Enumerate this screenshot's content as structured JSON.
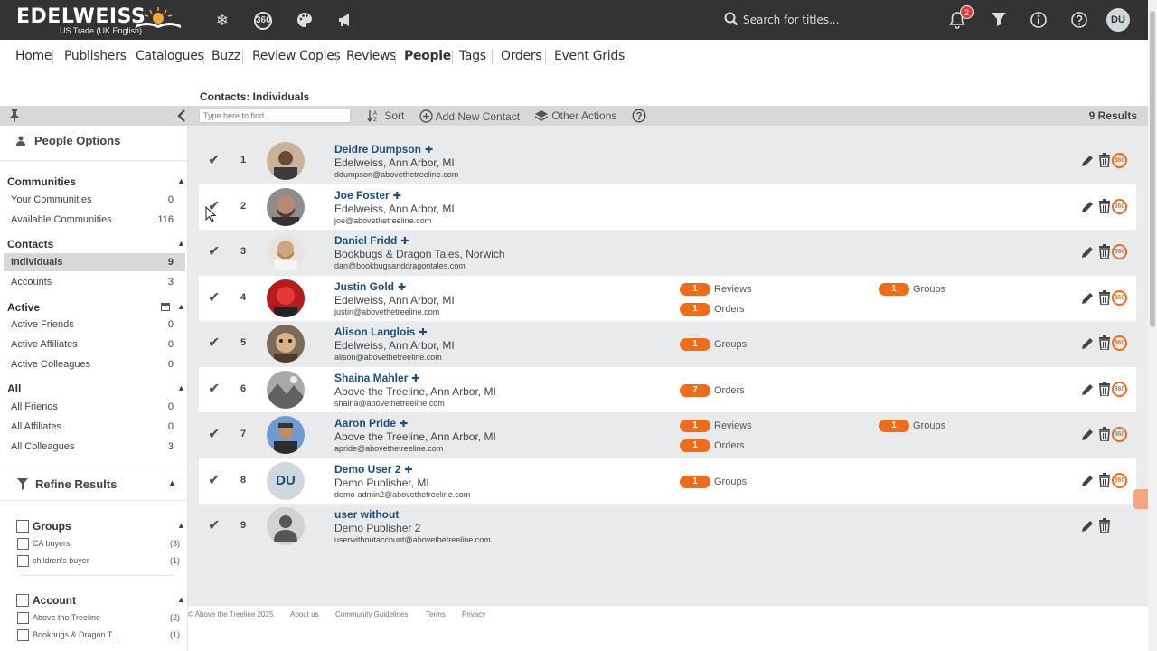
{
  "brand": {
    "name": "EDELWEISS",
    "subtitle": "US Trade (UK English)"
  },
  "header": {
    "search_placeholder": "Search for titles...",
    "notification_count": "2",
    "user_initials": "DU",
    "icon_360": "360"
  },
  "nav": [
    "Home",
    "Publishers",
    "Catalogues",
    "Buzz",
    "Review Copies",
    "Reviews",
    "People",
    "Tags",
    "Orders",
    "Event Grids"
  ],
  "breadcrumb": "Contacts: Individuals",
  "toolbar": {
    "find_placeholder": "Type here to find...",
    "sort": "Sort",
    "add_contact": "Add New Contact",
    "other_actions": "Other Actions",
    "results": "9 Results"
  },
  "sidebar": {
    "title": "People Options",
    "communities_head": "Communities",
    "communities": [
      {
        "label": "Your Communities",
        "count": "0"
      },
      {
        "label": "Available Communities",
        "count": "116"
      }
    ],
    "contacts_head": "Contacts",
    "contacts": [
      {
        "label": "Individuals",
        "count": "9"
      },
      {
        "label": "Accounts",
        "count": "3"
      }
    ],
    "active_head": "Active",
    "active": [
      {
        "label": "Active Friends",
        "count": "0"
      },
      {
        "label": "Active Affiliates",
        "count": "0"
      },
      {
        "label": "Active Colleagues",
        "count": "0"
      }
    ],
    "all_head": "All",
    "all": [
      {
        "label": "All Friends",
        "count": "0"
      },
      {
        "label": "All Affiliates",
        "count": "0"
      },
      {
        "label": "All Colleagues",
        "count": "3"
      }
    ],
    "refine_title": "Refine Results",
    "groups_head": "Groups",
    "groups": [
      {
        "label": "CA buyers",
        "count": "(3)"
      },
      {
        "label": "children's buyer",
        "count": "(1)"
      }
    ],
    "account_head": "Account",
    "accounts": [
      {
        "label": "Above the Treeline",
        "count": "(2)"
      },
      {
        "label": "Bookbugs & Dragon T...",
        "count": "(1)"
      }
    ]
  },
  "contacts": [
    {
      "num": "1",
      "name": "Deidre Dumpson",
      "org": "Edelweiss, Ann Arbor, MI",
      "email": "ddumpson@abovethetreeline.com"
    },
    {
      "num": "2",
      "name": "Joe Foster",
      "org": "Edelweiss, Ann Arbor, MI",
      "email": "joe@abovethetreeline.com"
    },
    {
      "num": "3",
      "name": "Daniel Fridd",
      "org": "Bookbugs & Dragon Tales, Norwich",
      "email": "dan@bookbugsanddragontales.com"
    },
    {
      "num": "4",
      "name": "Justin Gold",
      "org": "Edelweiss, Ann Arbor, MI",
      "email": "justin@abovethetreeline.com",
      "stats": [
        {
          "count": "1",
          "label": "Reviews"
        },
        {
          "count": "1",
          "label": "Orders"
        },
        {
          "count": "1",
          "label": "Groups"
        }
      ]
    },
    {
      "num": "5",
      "name": "Alison Langlois",
      "org": "Edelweiss, Ann Arbor, MI",
      "email": "alison@abovethetreeline.com",
      "stats": [
        {
          "count": "1",
          "label": "Groups"
        }
      ]
    },
    {
      "num": "6",
      "name": "Shaina Mahler",
      "org": "Above the Treeline, Ann Arbor, MI",
      "email": "shaina@abovethetreeline.com",
      "stats": [
        {
          "count": "7",
          "label": "Orders"
        }
      ]
    },
    {
      "num": "7",
      "name": "Aaron Pride",
      "org": "Above the Treeline, Ann Arbor, MI",
      "email": "apride@abovethetreeline.com",
      "stats": [
        {
          "count": "1",
          "label": "Reviews"
        },
        {
          "count": "1",
          "label": "Orders"
        },
        {
          "count": "1",
          "label": "Groups"
        }
      ]
    },
    {
      "num": "8",
      "name": "Demo User 2",
      "org": "Demo Publisher, MI",
      "email": "demo-admin2@abovethetreeline.com",
      "initials": "DU",
      "stats": [
        {
          "count": "1",
          "label": "Groups"
        }
      ]
    },
    {
      "num": "9",
      "name": "user without",
      "org": "Demo Publisher 2",
      "email": "userwithoutaccount@abovethetreeline.com"
    }
  ],
  "footer": {
    "copyright": "© Above the Treeline 2025",
    "links": [
      "About us",
      "Community Guidelines",
      "Terms",
      "Privacy"
    ]
  },
  "colors": {
    "accent": "#ef6c1b",
    "link": "#1a4f7a",
    "topbar": "#333333",
    "badge": "#e53935"
  }
}
